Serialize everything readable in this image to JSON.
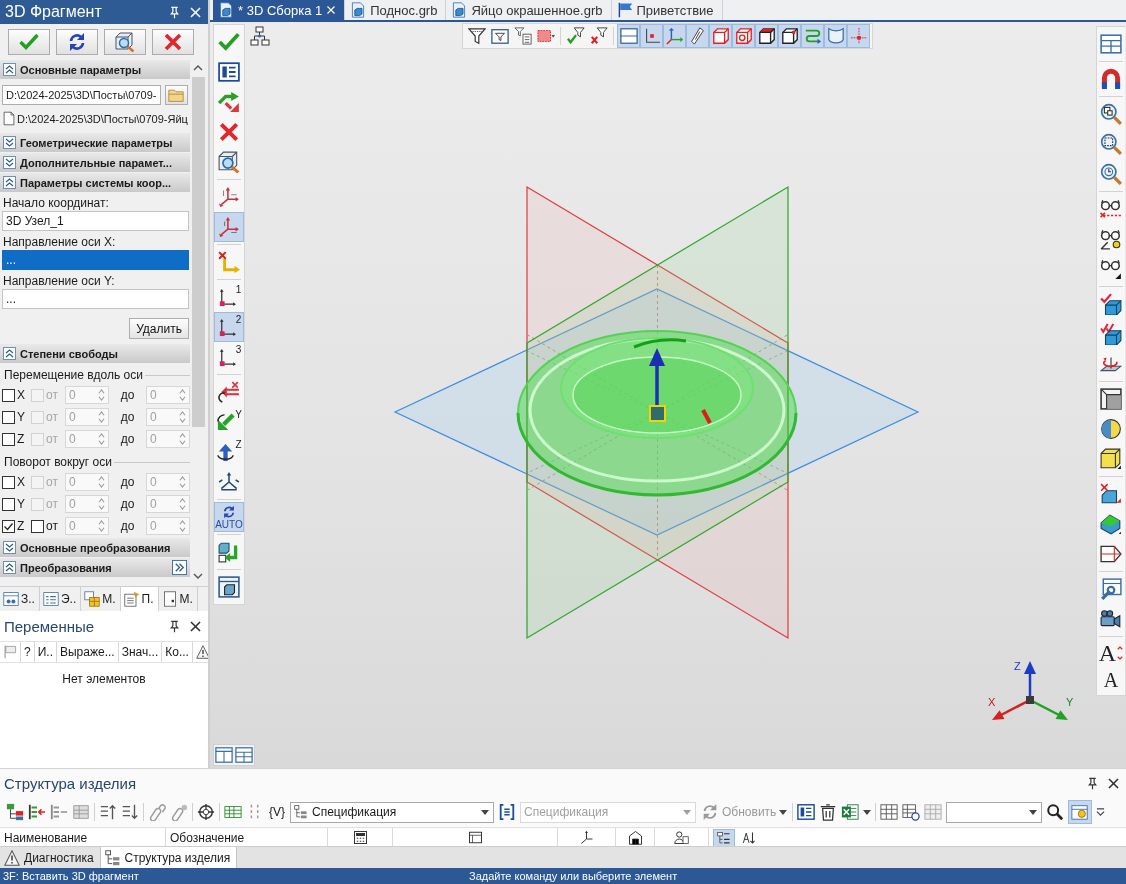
{
  "fragment_panel": {
    "title": "3D Фрагмент",
    "sections": [
      {
        "kind": "file",
        "title": "Основные параметры",
        "expanded": true,
        "path": "D:\\2024-2025\\3D\\Посты\\0709-",
        "file": "D:\\2024-2025\\3D\\Посты\\0709-Яйц"
      },
      {
        "kind": "header",
        "title": "Геометрические параметры",
        "expanded": false
      },
      {
        "kind": "header",
        "title": "Дополнительные парамет...",
        "expanded": false
      },
      {
        "kind": "coords",
        "title": "Параметры системы коор...",
        "expanded": true,
        "fields": [
          {
            "label": "Начало координат:",
            "value": "3D Узел_1",
            "selected": false
          },
          {
            "label": "Направление оси X:",
            "value": "...",
            "selected": true
          },
          {
            "label": "Направление оси Y:",
            "value": "...",
            "selected": false
          }
        ],
        "button": "Удалить"
      },
      {
        "kind": "freedom",
        "title": "Степени свободы",
        "expanded": true,
        "groups": [
          {
            "title": "Перемещение вдоль оси",
            "rows": [
              {
                "axis": "X",
                "checked": false,
                "limit_checked": false,
                "limit_disabled": true,
                "from_label": "от",
                "from": "0",
                "to_label": "до",
                "to": "0"
              },
              {
                "axis": "Y",
                "checked": false,
                "limit_checked": false,
                "limit_disabled": true,
                "from_label": "от",
                "from": "0",
                "to_label": "до",
                "to": "0"
              },
              {
                "axis": "Z",
                "checked": false,
                "limit_checked": false,
                "limit_disabled": true,
                "from_label": "от",
                "from": "0",
                "to_label": "до",
                "to": "0"
              }
            ]
          },
          {
            "title": "Поворот вокруг оси",
            "rows": [
              {
                "axis": "X",
                "checked": false,
                "limit_checked": false,
                "limit_disabled": true,
                "from_label": "от",
                "from": "0",
                "to_label": "до",
                "to": "0"
              },
              {
                "axis": "Y",
                "checked": false,
                "limit_checked": false,
                "limit_disabled": true,
                "from_label": "от",
                "from": "0",
                "to_label": "до",
                "to": "0"
              },
              {
                "axis": "Z",
                "checked": true,
                "limit_checked": false,
                "limit_disabled": false,
                "from_label": "от",
                "from": "0",
                "to_label": "до",
                "to": "0"
              }
            ]
          }
        ]
      },
      {
        "kind": "header",
        "title": "Основные преобразования",
        "expanded": false
      },
      {
        "kind": "more",
        "title": "Преобразования",
        "expanded": true
      }
    ],
    "tabs": [
      {
        "kind": "window",
        "label": "З..",
        "selected": false
      },
      {
        "kind": "list",
        "label": "Э..",
        "selected": false
      },
      {
        "kind": "model",
        "label": "М.",
        "selected": false
      },
      {
        "kind": "properties",
        "label": "П.",
        "selected": true
      },
      {
        "kind": "page",
        "label": "М.",
        "selected": false
      }
    ]
  },
  "variables_panel": {
    "title": "Переменные",
    "columns": [
      "?",
      "И..",
      "Выраже...",
      "Знач...",
      "Ко..."
    ],
    "empty_text": "Нет элементов"
  },
  "document_tabs": [
    {
      "kind": "document",
      "label": "* 3D Сборка 1",
      "selected": true
    },
    {
      "kind": "document",
      "label": "Поднос.grb",
      "selected": false
    },
    {
      "kind": "document",
      "label": "Яйцо окрашенное.grb",
      "selected": false
    },
    {
      "kind": "welcome",
      "label": "Приветствие",
      "selected": false
    }
  ],
  "filter_toolbar": [
    {
      "kind": "funnel",
      "selected": false
    },
    {
      "kind": "funnel_box",
      "selected": false
    },
    {
      "kind": "funnel_list",
      "selected": false
    },
    {
      "kind": "rect_select",
      "selected": false
    },
    {
      "kind": "funnel_check",
      "selected": false
    },
    {
      "kind": "funnel_cross",
      "selected": false
    },
    {
      "kind": "face",
      "selected": true
    },
    {
      "kind": "point",
      "selected": true
    },
    {
      "kind": "axes_color",
      "selected": true
    },
    {
      "kind": "edge",
      "selected": true
    },
    {
      "kind": "cube_red",
      "selected": true
    },
    {
      "kind": "cube_circle",
      "selected": true
    },
    {
      "kind": "cube_face",
      "selected": true
    },
    {
      "kind": "cube_black",
      "selected": true
    },
    {
      "kind": "curve",
      "selected": true
    },
    {
      "kind": "shell",
      "selected": true
    },
    {
      "kind": "axis_point",
      "selected": true
    }
  ],
  "left_toolbar": [
    {
      "kind": "check",
      "selected": false
    },
    {
      "kind": "form",
      "selected": false
    },
    {
      "kind": "split",
      "selected": false
    },
    {
      "kind": "cross",
      "selected": false
    },
    {
      "kind": "cube_zoom",
      "selected": false
    },
    {
      "kind": "axes",
      "selected": false
    },
    {
      "kind": "axes_alt",
      "selected": true
    },
    {
      "kind": "axes_x",
      "selected": false
    },
    {
      "kind": "axes_pt",
      "label": "1",
      "selected": false
    },
    {
      "kind": "axes_pt",
      "label": "2",
      "selected": true
    },
    {
      "kind": "axes_pt",
      "label": "3",
      "selected": false
    },
    {
      "kind": "arrows_x",
      "selected": false
    },
    {
      "kind": "arrow_y",
      "label": "Y",
      "selected": false
    },
    {
      "kind": "arrow_z",
      "label": "Z",
      "selected": false
    },
    {
      "kind": "tri",
      "selected": false
    },
    {
      "kind": "auto",
      "label": "AUTO",
      "selected": true
    },
    {
      "kind": "cube_insert",
      "selected": false
    },
    {
      "kind": "window_cube",
      "selected": false
    }
  ],
  "right_toolbar": [
    {
      "kind": "layout"
    },
    {
      "kind": "magnet"
    },
    {
      "kind": "zoom_window"
    },
    {
      "kind": "zoom_box"
    },
    {
      "kind": "zoom_prev"
    },
    {
      "kind": "glasses_line"
    },
    {
      "kind": "glasses_angle"
    },
    {
      "kind": "glasses"
    },
    {
      "kind": "cube_check"
    },
    {
      "kind": "cube_check2"
    },
    {
      "kind": "plane_rotate"
    },
    {
      "kind": "cube_box"
    },
    {
      "kind": "sphere"
    },
    {
      "kind": "cube_yellow"
    },
    {
      "kind": "cube_point"
    },
    {
      "kind": "cube_green"
    },
    {
      "kind": "prism"
    },
    {
      "kind": "wrench"
    },
    {
      "kind": "camera"
    },
    {
      "kind": "text_size",
      "label": "A"
    },
    {
      "kind": "text",
      "label": "A"
    }
  ],
  "viewport": {
    "triad": {
      "x": "X",
      "y": "Y",
      "z": "Z"
    }
  },
  "structure_panel": {
    "title": "Структура изделия",
    "variables": "{V}",
    "view_select": "Спецификация",
    "spec_select": {
      "value": "Спецификация",
      "disabled": true
    },
    "refresh_button": {
      "label": "Обновить",
      "disabled": true
    },
    "settings_button": {
      "selected": true
    },
    "columns": [
      "Наименование",
      "Обозначение"
    ],
    "sort_toggles": [
      {
        "selected": true
      },
      {
        "selected": false
      }
    ]
  },
  "bottom_tabs": [
    {
      "kind": "diagnostics",
      "label": "Диагностика",
      "selected": false
    },
    {
      "kind": "structure",
      "label": "Структура изделия",
      "selected": true
    }
  ],
  "status_bar": {
    "command": "3F: Вставить 3D фрагмент",
    "prompt": "Задайте команду или выберите элемент"
  }
}
